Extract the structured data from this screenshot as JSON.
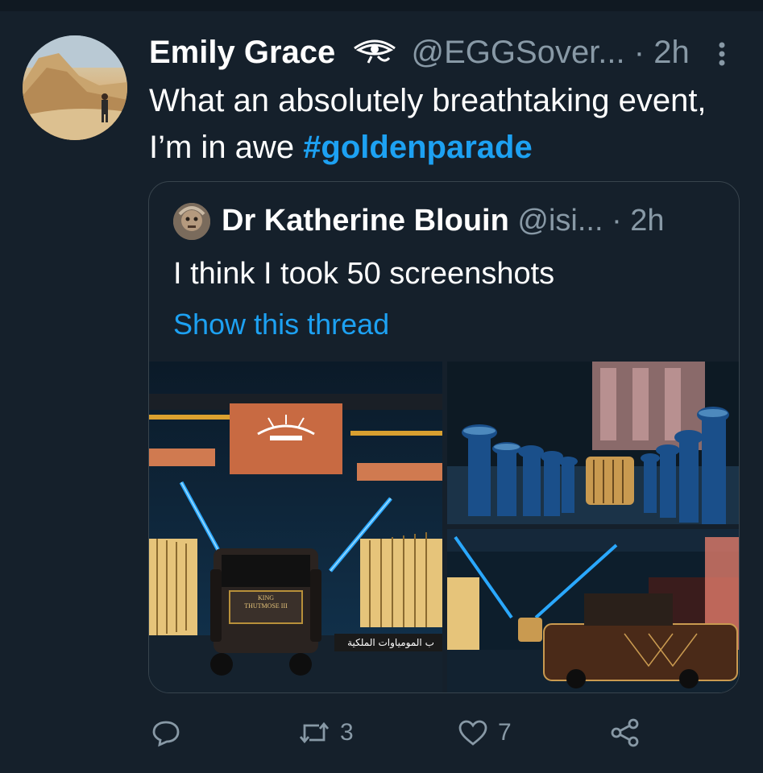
{
  "tweet": {
    "author_name": "Emily Grace",
    "handle": "@EGGSover...",
    "time": "· 2h",
    "text": "What an absolutely breathtaking event, I’m in awe",
    "hashtag": "#goldenparade"
  },
  "quote": {
    "author_name": "Dr Katherine Blouin",
    "handle": "@isi...",
    "time": "· 2h",
    "text": "I think I took 50 screenshots",
    "thread_link": "Show this thread",
    "images": {
      "main_plate_line1": "KING",
      "main_plate_line2": "THUTMOSE III",
      "main_banner": "ب المومياوات الملكية"
    }
  },
  "actions": {
    "reply_count": "",
    "retweet_count": "3",
    "like_count": "7"
  },
  "colors": {
    "background": "#15202b",
    "accent": "#1da1f2",
    "muted": "#8899a6",
    "border": "#38444d"
  },
  "icons": [
    "eye-of-horus-icon",
    "more-vertical-icon",
    "reply-icon",
    "retweet-icon",
    "heart-icon",
    "share-icon"
  ]
}
